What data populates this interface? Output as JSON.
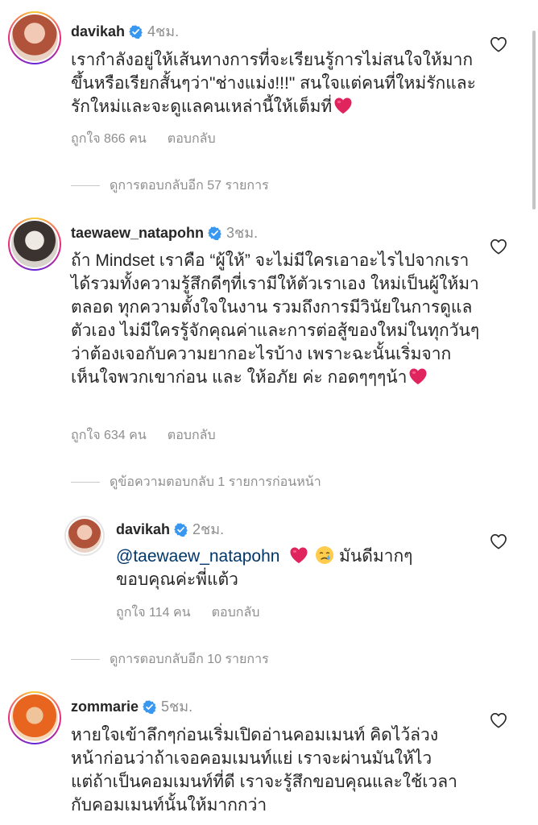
{
  "comments": [
    {
      "username": "davikah",
      "time": "4ชม.",
      "text": "เรากำลังอยู่ให้เส้นทางการที่จะเรียนรู้การไม่สนใจให้มากขึ้นหรือเรียกสั้นๆว่า\"ช่างแม่ง!!!\" สนใจแต่คนที่ใหม่รักและรักใหม่และจะดูแลคนเหล่านี้ให้เต็มที่",
      "likes": "ถูกใจ 866 คน",
      "reply": "ตอบกลับ",
      "more_replies": "ดูการตอบกลับอีก 57 รายการ"
    },
    {
      "username": "taewaew_natapohn",
      "time": "3ชม.",
      "text": "ถ้า Mindset เราคือ “ผู้ให้” จะไม่มีใครเอาอะไรไปจากเราได้รวมทั้งความรู้สึกดีๆที่เรามีให้ตัวเราเอง ใหม่เป็นผู้ให้มาตลอด ทุกความตั้งใจในงาน รวมถึงการมีวินัยในการดูแลตัวเอง ไม่มีใครรู้จักคุณค่าและการต่อสู้ของใหม่ในทุกวันๆว่าต้องเจอกับความยากอะไรบ้าง เพราะฉะนั้นเริ่มจาก เห็นใจพวกเขาก่อน และ ให้อภัย ค่ะ กอดๆๆๆน้า",
      "likes": "ถูกใจ 634 คน",
      "reply": "ตอบกลับ",
      "previous_replies": "ดูข้อความตอบกลับ 1 รายการก่อนหน้า"
    },
    {
      "username": "davikah",
      "time": "2ชม.",
      "mention": "@taewaew_natapohn",
      "text_after_emoji": "มันดีมากๆ",
      "text_line2": "ขอบคุณค่ะพี่แต้ว",
      "likes": "ถูกใจ 114 คน",
      "reply": "ตอบกลับ",
      "more_replies": "ดูการตอบกลับอีก 10 รายการ"
    },
    {
      "username": "zommarie",
      "time": "5ชม.",
      "text": "หายใจเข้าลึกๆก่อนเริ่มเปิดอ่านคอมเมนท์ คิดไว้ล่วงหน้าก่อนว่าถ้าเจอคอมเมนท์แย่ เราจะผ่านมันให้ไว แต่ถ้าเป็นคอมเมนท์ที่ดี เราจะรู้สึกขอบคุณและใช้เวลากับคอมเมนท์นั้นให้มากกว่า"
    }
  ],
  "icons": {
    "heart_outline": "heart-outline-icon",
    "heart_emoji": "red-heart-emoji",
    "crying_emoji": "crying-face-emoji",
    "verified": "verified-badge-icon"
  },
  "colors": {
    "verified": "#3897f0",
    "heart_emoji": "#e0245e",
    "mention": "#00376b",
    "muted": "#8e8e8e"
  }
}
